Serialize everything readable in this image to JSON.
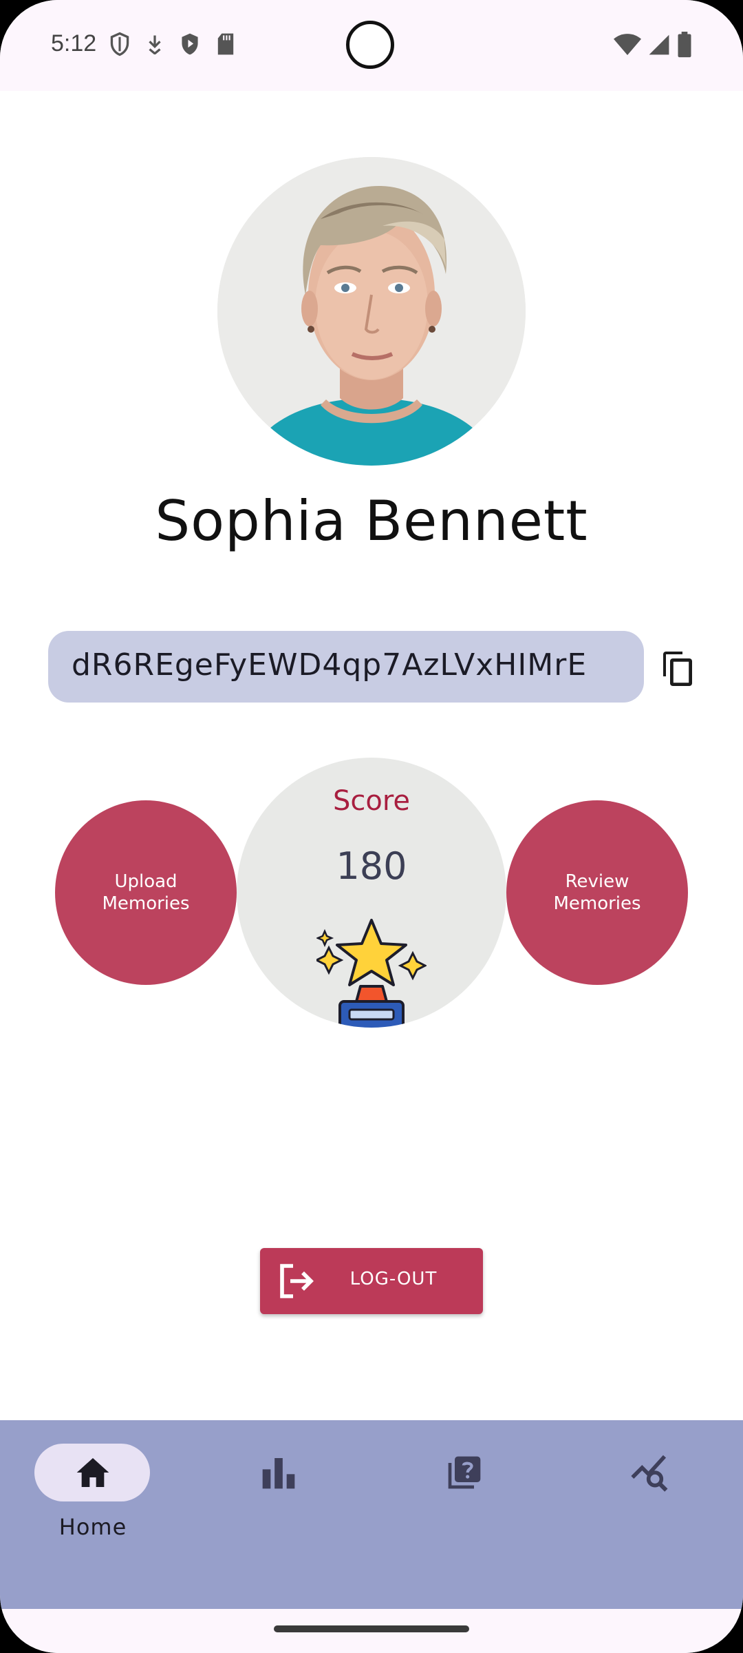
{
  "status_bar": {
    "time": "5:12",
    "left_icons": [
      "shield-outline-icon",
      "download-arrow-icon",
      "play-shield-icon",
      "sd-card-icon"
    ],
    "right_icons": [
      "wifi-icon",
      "cell-signal-icon",
      "battery-icon"
    ]
  },
  "profile": {
    "name": "Sophia Bennett",
    "avatar": "profile-photo",
    "user_id": "dR6REgeFyEWD4qp7AzLVxHIMrE"
  },
  "actions": {
    "upload_line1": "Upload",
    "upload_line2": "Memories",
    "review_line1": "Review",
    "review_line2": "Memories"
  },
  "score": {
    "label": "Score",
    "value": "180"
  },
  "logout": {
    "label": "LOG-OUT"
  },
  "bottom_nav": {
    "items": [
      {
        "label": "Home",
        "icon": "home-icon",
        "selected": true
      },
      {
        "label": "",
        "icon": "bar-chart-icon",
        "selected": false
      },
      {
        "label": "",
        "icon": "quiz-icon",
        "selected": false
      },
      {
        "label": "",
        "icon": "query-stats-icon",
        "selected": false
      }
    ]
  },
  "colors": {
    "accent": "#bc435e",
    "score_text": "#a81e3f",
    "nav_background": "#979fca",
    "id_pill": "#c8cce3"
  }
}
